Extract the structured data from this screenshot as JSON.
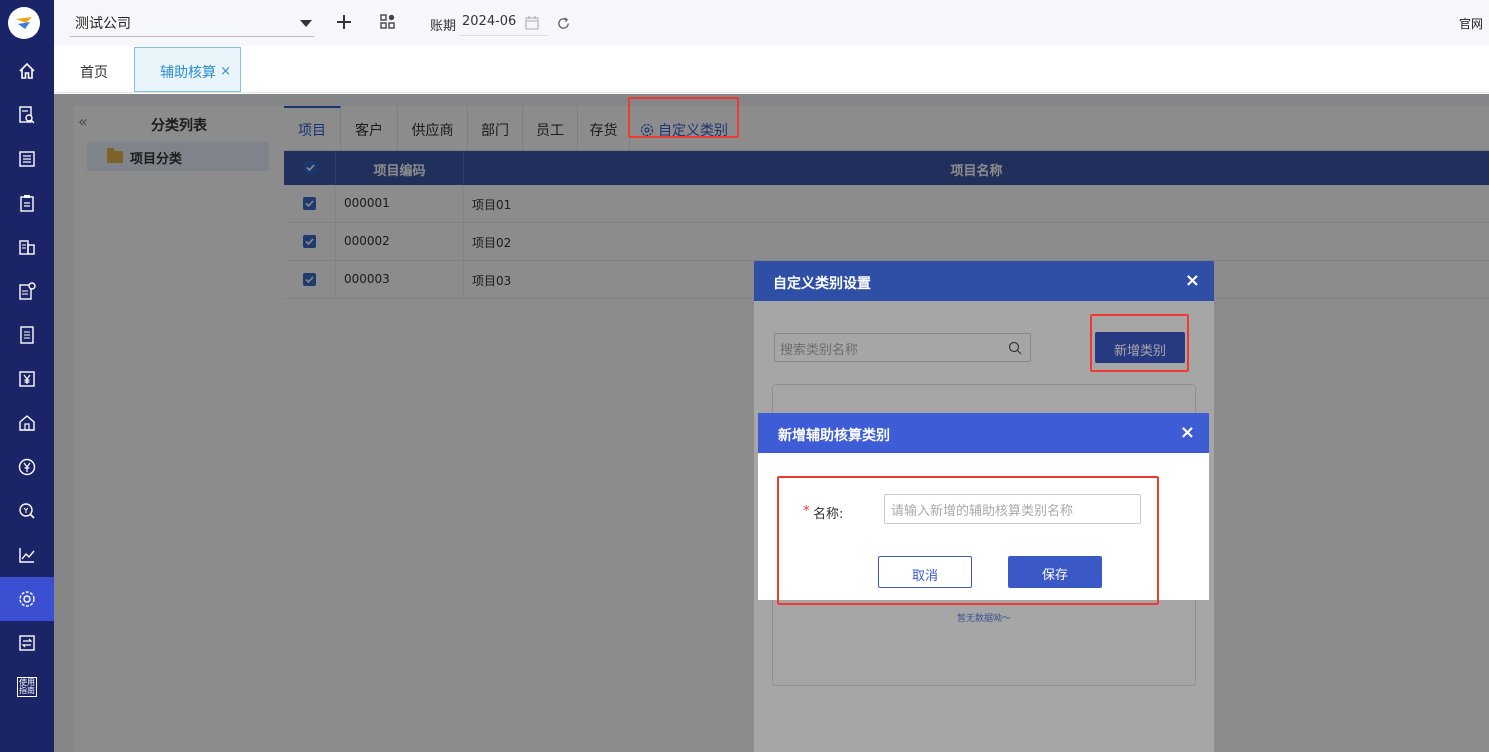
{
  "header": {
    "company": "测试公司",
    "period_label": "账期",
    "period_value": "2024-06",
    "official_site": "官网"
  },
  "nav": {
    "guide_line1": "使用",
    "guide_line2": "指南",
    "items": [
      "home-icon",
      "ledger-search-icon",
      "list-icon",
      "clipboard-icon",
      "building-icon",
      "doc-settings-icon",
      "document-icon",
      "yen-icon",
      "warehouse-icon",
      "yen-circle-icon",
      "money-search-icon",
      "chart-icon",
      "gear-icon",
      "transfer-icon"
    ]
  },
  "tabs": {
    "home": "首页",
    "active": "辅助核算",
    "active_close": "×"
  },
  "side": {
    "collapse": "«",
    "title": "分类列表",
    "item": "项目分类"
  },
  "category_tabs": [
    "项目",
    "客户",
    "供应商",
    "部门",
    "员工",
    "存货"
  ],
  "custom_tab": "自定义类别",
  "table": {
    "col_code": "项目编码",
    "col_name": "项目名称",
    "rows": [
      {
        "code": "000001",
        "name": "项目01"
      },
      {
        "code": "000002",
        "name": "项目02"
      },
      {
        "code": "000003",
        "name": "项目03"
      }
    ]
  },
  "dialog_custom": {
    "title": "自定义类别设置",
    "close": "×",
    "search_placeholder": "搜索类别名称",
    "add_button": "新增类别",
    "empty_text": "暂无数据呦～"
  },
  "dialog_add": {
    "title": "新增辅助核算类别",
    "close": "×",
    "required_mark": "*",
    "name_label": "名称:",
    "name_placeholder": "请输入新增的辅助核算类别名称",
    "cancel": "取消",
    "save": "保存"
  },
  "colors": {
    "nav_bg": "#1b2466",
    "nav_active": "#3a4fd1",
    "table_header": "#3c57a9",
    "primary": "#3b58c7",
    "highlight": "#ee3b32"
  }
}
